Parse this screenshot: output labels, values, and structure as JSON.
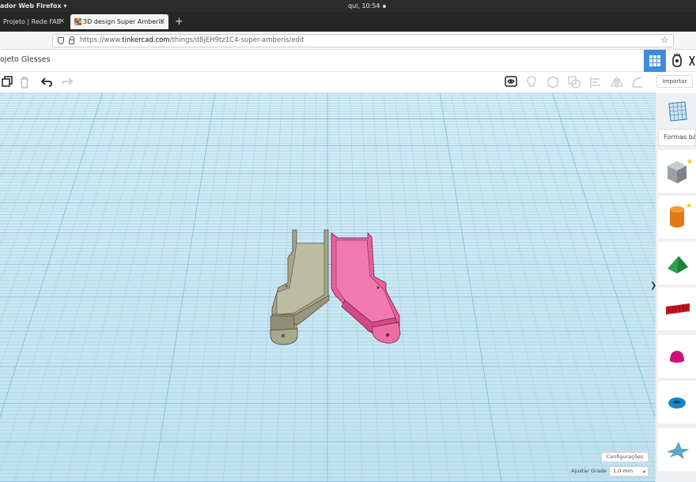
{
  "os_bar": {
    "app_menu": "ador Web Firefox ▾",
    "clock": "qui, 10:54"
  },
  "browser": {
    "tabs": [
      {
        "label": "Projeto | Rede FAB",
        "close": "×"
      },
      {
        "label": "3D design Super Amberis",
        "close": "×"
      }
    ],
    "new_tab": "+",
    "url_base": "https://www.",
    "url_domain": "tinkercad.com",
    "url_path": "/things/d8jEH9tz1C4-super-amberis/edit"
  },
  "app": {
    "title": "ojeto Glesses",
    "import_label": "Importar",
    "shapes_dropdown": "Formas bá",
    "settings_label": "Configurações",
    "grid_label": "Ajustar Grade",
    "grid_value": "1,0 mm",
    "colors": {
      "accent": "#3c8ddb",
      "part_left": "#a6a68a",
      "part_right": "#e9609a",
      "workplane": "#c9e6f2"
    }
  },
  "toolbar_icons": [
    "copy-icon",
    "delete-icon",
    "undo-icon",
    "redo-icon",
    "notes-visibility-icon",
    "light-icon",
    "shape-icon",
    "group-icon",
    "align-icon",
    "mirror-icon",
    "ruler-icon"
  ],
  "shapes": [
    "workplane-grid",
    "box",
    "cylinder",
    "pyramid",
    "text",
    "half-sphere",
    "torus",
    "star"
  ]
}
